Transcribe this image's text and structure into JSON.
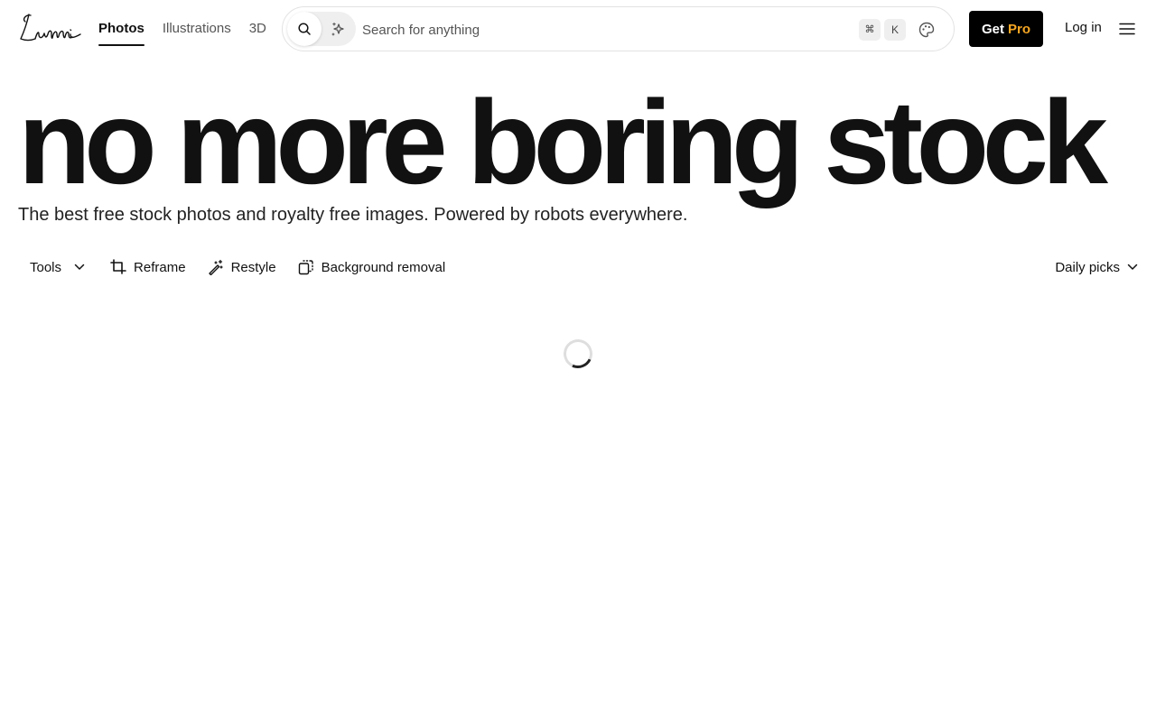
{
  "brand": {
    "logo_text": "Lummi"
  },
  "nav": {
    "tabs": [
      {
        "label": "Photos",
        "active": true
      },
      {
        "label": "Illustrations",
        "active": false
      },
      {
        "label": "3D",
        "active": false
      }
    ]
  },
  "search": {
    "placeholder": "Search for anything",
    "value": "",
    "shortcut_keys": [
      "⌘",
      "K"
    ],
    "icons": [
      "search-icon",
      "sparkle-icon",
      "palette-icon"
    ]
  },
  "header_actions": {
    "get_label": "Get",
    "pro_label": "Pro",
    "login_label": "Log in",
    "menu_icon": "hamburger-icon"
  },
  "hero": {
    "headline": "no more boring stock",
    "subtitle": "The best free stock photos and royalty free images. Powered by robots everywhere."
  },
  "toolbar": {
    "tools_label": "Tools",
    "items": [
      {
        "label": "Reframe",
        "icon": "crop-icon"
      },
      {
        "label": "Restyle",
        "icon": "magic-wand-icon"
      },
      {
        "label": "Background removal",
        "icon": "background-removal-icon"
      }
    ],
    "sort_label": "Daily picks"
  },
  "colors": {
    "accent_pro": "#f5a623",
    "button_bg": "#000000",
    "text": "#111111",
    "muted": "#555555"
  },
  "status": {
    "loading": true
  }
}
